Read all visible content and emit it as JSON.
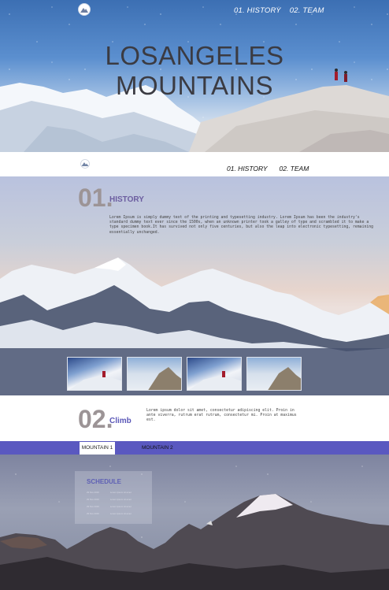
{
  "hero": {
    "title_line1": "LOSANGELES",
    "title_line2": "MOUNTAINS",
    "nav": [
      "01. HISTORY",
      "02. TEAM"
    ]
  },
  "navbar": {
    "links": [
      "01. HISTORY",
      "02. TEAM"
    ]
  },
  "history": {
    "number": "01.",
    "title": "HISTORY",
    "text": "Lorem Ipsum is simply dummy text of the printing and typesetting industry. Lorem Ipsum has been the industry's standard dummy text ever since the 1500s, when an unknown printer took a galley of type and scrambled it to make a type specimen book.It has survived not only five centuries, but also the leap into electronic typesetting, remaining essentially unchanged."
  },
  "climb": {
    "number": "02.",
    "title": "Climb",
    "text": "Lorem ipsum dolor sit amet, consectetur adipiscing elit. Proin in ante viverra, rutrum erat rutrum, consectetur mi. Proin at maximus est."
  },
  "tabs": [
    "MOUNTAIN 1",
    "MOUNTAIN 2"
  ],
  "schedule": {
    "title": "SCHEDULE",
    "rows": [
      {
        "date": "29 Nov 2016",
        "desc": "Lorem Ipsum sit amet"
      },
      {
        "date": "29 Nov 2016",
        "desc": "Lorem Ipsum sit amet"
      },
      {
        "date": "29 Nov 2016",
        "desc": "Lorem Ipsum sit amet"
      },
      {
        "date": "29 Nov 2016",
        "desc": "Lorem Ipsum sit amet"
      }
    ]
  },
  "colors": {
    "accent": "#5a58c0",
    "section_number": "#9c9496",
    "title_dark": "#3b3b42"
  }
}
